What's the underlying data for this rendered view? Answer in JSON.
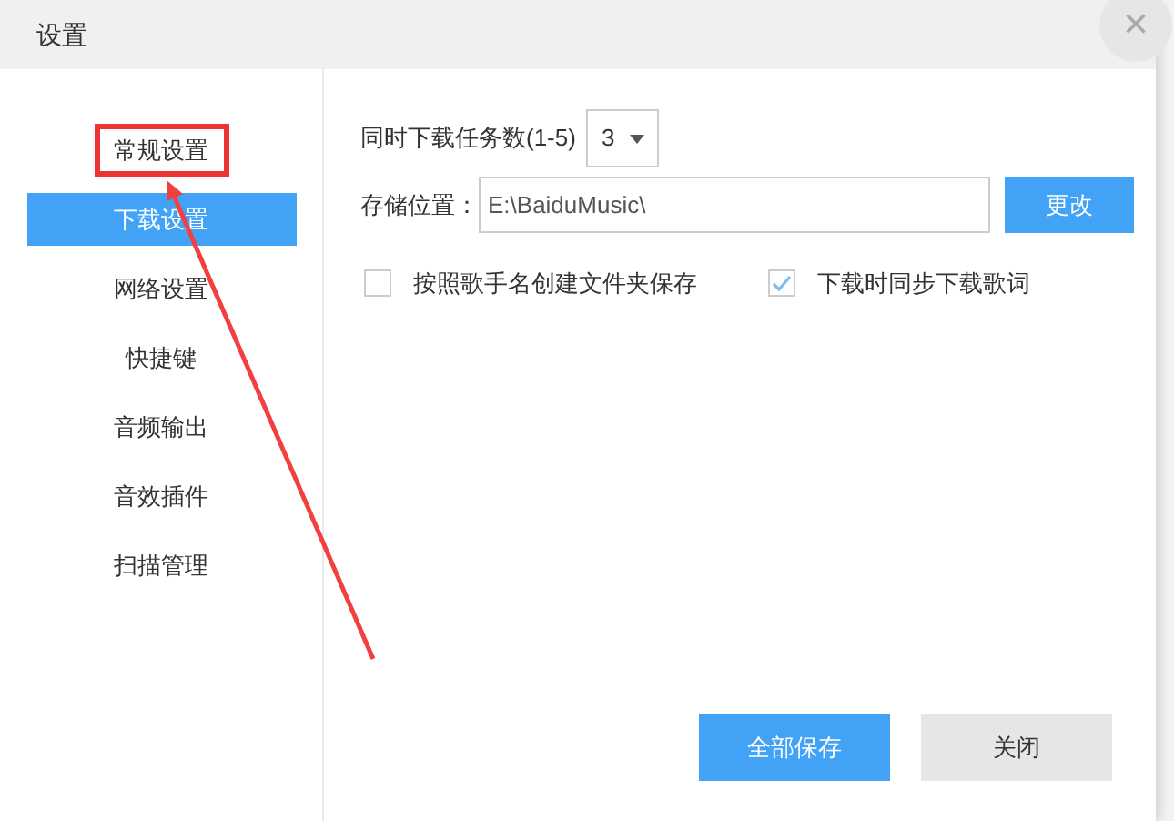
{
  "window": {
    "title": "设置",
    "close": "×"
  },
  "sidebar": {
    "items": [
      {
        "label": "常规设置",
        "selected": false,
        "highlighted": true
      },
      {
        "label": "下载设置",
        "selected": true,
        "highlighted": false
      },
      {
        "label": "网络设置",
        "selected": false,
        "highlighted": false
      },
      {
        "label": "快捷键",
        "selected": false,
        "highlighted": false
      },
      {
        "label": "音频输出",
        "selected": false,
        "highlighted": false
      },
      {
        "label": "音效插件",
        "selected": false,
        "highlighted": false
      },
      {
        "label": "扫描管理",
        "selected": false,
        "highlighted": false
      }
    ]
  },
  "task_count": {
    "label": "同时下载任务数(1-5)",
    "value": "3"
  },
  "storage": {
    "label": "存储位置：",
    "value": "E:\\BaiduMusic\\",
    "button": "更改"
  },
  "options": [
    {
      "label": "按照歌手名创建文件夹保存",
      "checked": false
    },
    {
      "label": "下载时同步下载歌词",
      "checked": true
    }
  ],
  "buttons": [
    {
      "label": "全部保存",
      "kind": "primary"
    },
    {
      "label": "关闭",
      "kind": "secondary"
    }
  ]
}
